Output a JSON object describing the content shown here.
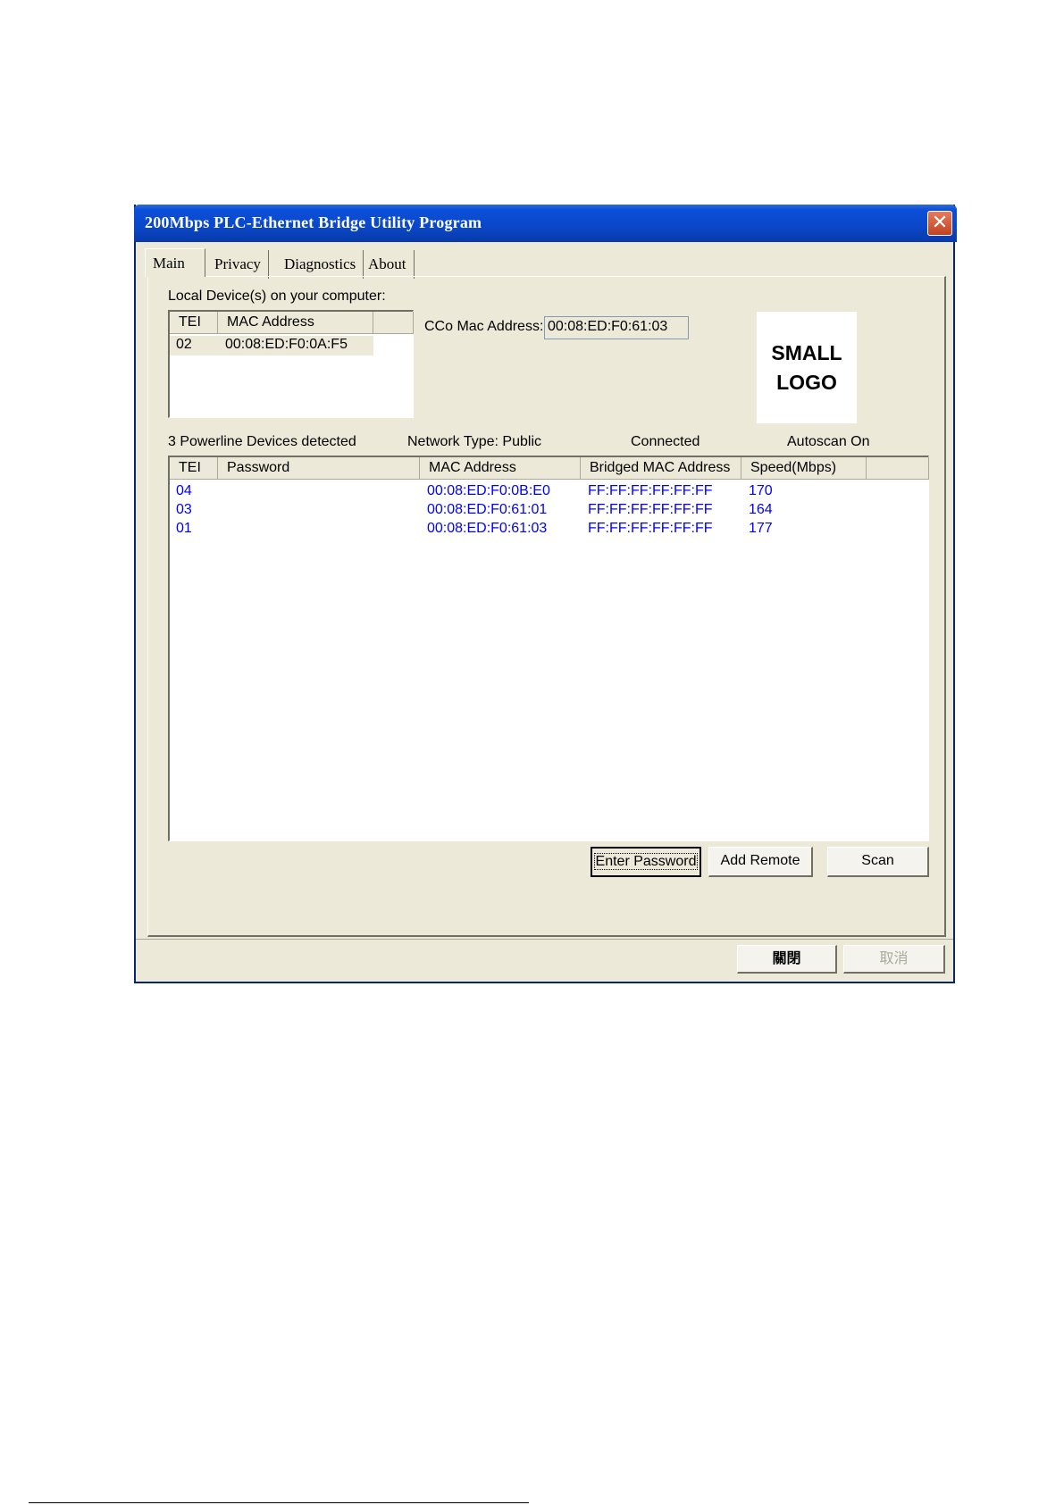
{
  "window": {
    "title": "200Mbps PLC-Ethernet Bridge Utility Program",
    "close_glyph": "✕"
  },
  "tabs": [
    {
      "label": "Main"
    },
    {
      "label": "Privacy"
    },
    {
      "label": "Diagnostics"
    },
    {
      "label": "About"
    }
  ],
  "local": {
    "heading": "Local Device(s) on your computer:",
    "columns": [
      "TEI",
      "MAC Address"
    ],
    "rows": [
      {
        "tei": "02",
        "mac": "00:08:ED:F0:0A:F5"
      }
    ]
  },
  "cco": {
    "label": "CCo Mac Address:",
    "value": "00:08:ED:F0:61:03"
  },
  "logo": {
    "text": "SMALL\nLOGO"
  },
  "status": {
    "detected": "3 Powerline Devices detected",
    "network_type": "Network Type: Public",
    "connection": "Connected",
    "autoscan": "Autoscan On"
  },
  "devices": {
    "columns": [
      "TEI",
      "Password",
      "MAC Address",
      "Bridged MAC Address",
      "Speed(Mbps)"
    ],
    "rows": [
      {
        "tei": "04",
        "password": "",
        "mac": "00:08:ED:F0:0B:E0",
        "bridged": "FF:FF:FF:FF:FF:FF",
        "speed": "170"
      },
      {
        "tei": "03",
        "password": "",
        "mac": "00:08:ED:F0:61:01",
        "bridged": "FF:FF:FF:FF:FF:FF",
        "speed": "164"
      },
      {
        "tei": "01",
        "password": "",
        "mac": "00:08:ED:F0:61:03",
        "bridged": "FF:FF:FF:FF:FF:FF",
        "speed": "177"
      }
    ],
    "row_color": "#0000ff"
  },
  "buttons": {
    "enter_password": "Enter Password",
    "add_remote": "Add Remote",
    "scan": "Scan",
    "close": "關閉",
    "cancel": "取消"
  }
}
